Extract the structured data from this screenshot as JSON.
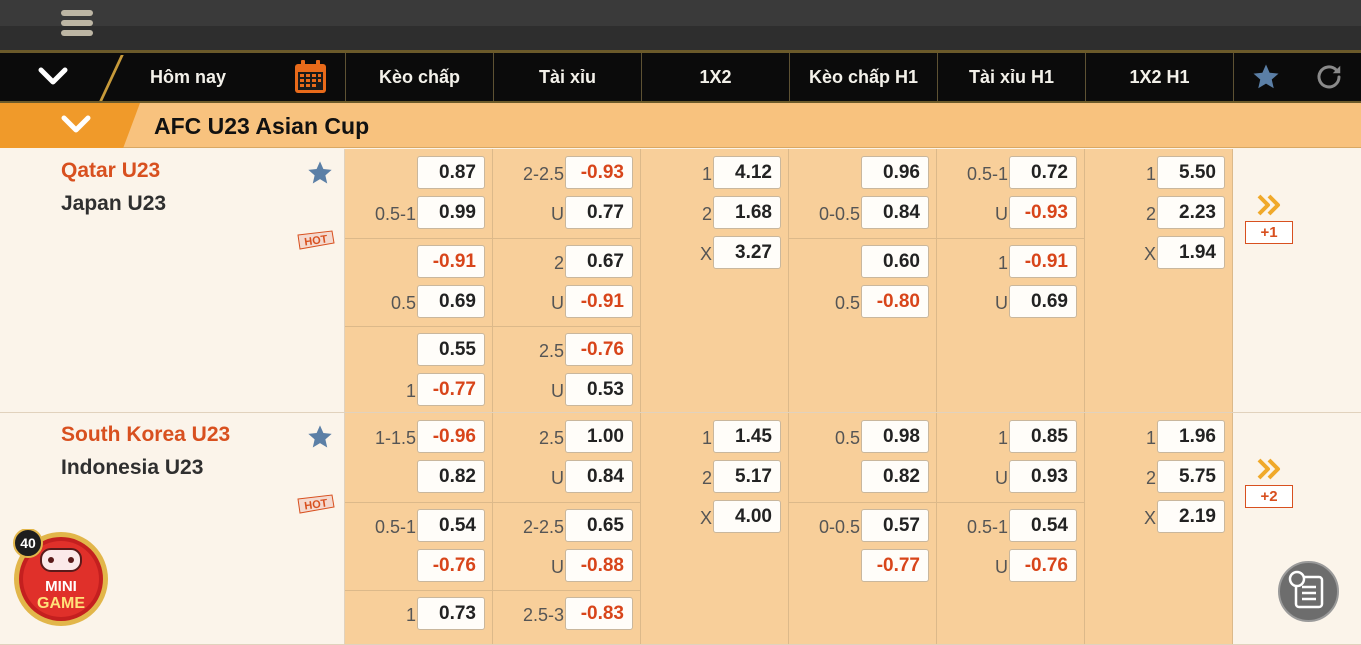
{
  "header": {
    "today_label": "Hôm nay",
    "columns": [
      "Kèo chấp",
      "Tài xỉu",
      "1X2",
      "Kèo chấp H1",
      "Tài xỉu H1",
      "1X2 H1"
    ]
  },
  "league": {
    "name": "AFC U23 Asian Cup"
  },
  "colors": {
    "accent": "#f09a2a",
    "negative": "#d8451a",
    "team_home": "#d8501f"
  },
  "icons": [
    "menu-icon",
    "chevron-down-icon",
    "calendar-icon",
    "star-icon",
    "refresh-icon",
    "hot-badge-icon",
    "double-chevron-right-icon",
    "minigame-icon",
    "bet-slip-icon"
  ],
  "minigame": {
    "count": "40",
    "label1": "MINI",
    "label2": "GAME"
  },
  "matches": [
    {
      "home": "Qatar U23",
      "away": "Japan U23",
      "more": "+1",
      "hot": "HOT",
      "handicap": [
        [
          {
            "l": "",
            "v": "0.87"
          },
          {
            "l": "0.5-1",
            "v": "0.99"
          }
        ],
        [
          {
            "l": "",
            "v": "-0.91"
          },
          {
            "l": "0.5",
            "v": "0.69"
          }
        ],
        [
          {
            "l": "",
            "v": "0.55"
          },
          {
            "l": "1",
            "v": "-0.77"
          }
        ]
      ],
      "overunder": [
        [
          {
            "l": "2-2.5",
            "v": "-0.93"
          },
          {
            "l": "U",
            "v": "0.77"
          }
        ],
        [
          {
            "l": "2",
            "v": "0.67"
          },
          {
            "l": "U",
            "v": "-0.91"
          }
        ],
        [
          {
            "l": "2.5",
            "v": "-0.76"
          },
          {
            "l": "U",
            "v": "0.53"
          }
        ]
      ],
      "x12": [
        {
          "l": "1",
          "v": "4.12"
        },
        {
          "l": "2",
          "v": "1.68"
        },
        {
          "l": "X",
          "v": "3.27"
        }
      ],
      "handicap_h1": [
        [
          {
            "l": "",
            "v": "0.96"
          },
          {
            "l": "0-0.5",
            "v": "0.84"
          }
        ],
        [
          {
            "l": "",
            "v": "0.60"
          },
          {
            "l": "0.5",
            "v": "-0.80"
          }
        ]
      ],
      "overunder_h1": [
        [
          {
            "l": "0.5-1",
            "v": "0.72"
          },
          {
            "l": "U",
            "v": "-0.93"
          }
        ],
        [
          {
            "l": "1",
            "v": "-0.91"
          },
          {
            "l": "U",
            "v": "0.69"
          }
        ]
      ],
      "x12_h1": [
        {
          "l": "1",
          "v": "5.50"
        },
        {
          "l": "2",
          "v": "2.23"
        },
        {
          "l": "X",
          "v": "1.94"
        }
      ]
    },
    {
      "home": "South Korea U23",
      "away": "Indonesia U23",
      "more": "+2",
      "hot": "HOT",
      "handicap": [
        [
          {
            "l": "1-1.5",
            "v": "-0.96"
          },
          {
            "l": "",
            "v": "0.82"
          }
        ],
        [
          {
            "l": "0.5-1",
            "v": "0.54"
          },
          {
            "l": "",
            "v": "-0.76"
          }
        ],
        [
          {
            "l": "1",
            "v": "0.73"
          }
        ]
      ],
      "overunder": [
        [
          {
            "l": "2.5",
            "v": "1.00"
          },
          {
            "l": "U",
            "v": "0.84"
          }
        ],
        [
          {
            "l": "2-2.5",
            "v": "0.65"
          },
          {
            "l": "U",
            "v": "-0.88"
          }
        ],
        [
          {
            "l": "2.5-3",
            "v": "-0.83"
          }
        ]
      ],
      "x12": [
        {
          "l": "1",
          "v": "1.45"
        },
        {
          "l": "2",
          "v": "5.17"
        },
        {
          "l": "X",
          "v": "4.00"
        }
      ],
      "handicap_h1": [
        [
          {
            "l": "0.5",
            "v": "0.98"
          },
          {
            "l": "",
            "v": "0.82"
          }
        ],
        [
          {
            "l": "0-0.5",
            "v": "0.57"
          },
          {
            "l": "",
            "v": "-0.77"
          }
        ]
      ],
      "overunder_h1": [
        [
          {
            "l": "1",
            "v": "0.85"
          },
          {
            "l": "U",
            "v": "0.93"
          }
        ],
        [
          {
            "l": "0.5-1",
            "v": "0.54"
          },
          {
            "l": "U",
            "v": "-0.76"
          }
        ]
      ],
      "x12_h1": [
        {
          "l": "1",
          "v": "1.96"
        },
        {
          "l": "2",
          "v": "5.75"
        },
        {
          "l": "X",
          "v": "2.19"
        }
      ]
    }
  ]
}
